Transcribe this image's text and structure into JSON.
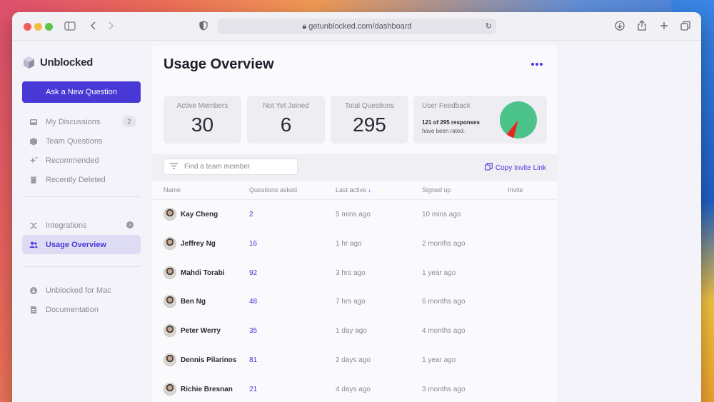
{
  "browser": {
    "url": "getunblocked.com/dashboard"
  },
  "sidebar": {
    "app_name": "Unblocked",
    "ask_button": "Ask a New Question",
    "items": [
      {
        "label": "My Discussions",
        "icon": "inbox-icon",
        "badge": "2"
      },
      {
        "label": "Team Questions",
        "icon": "cube-icon"
      },
      {
        "label": "Recommended",
        "icon": "sparkle-icon"
      },
      {
        "label": "Recently Deleted",
        "icon": "trash-icon"
      },
      {
        "label": "Integrations",
        "icon": "shuffle-icon"
      },
      {
        "label": "Usage Overview",
        "icon": "users-icon",
        "active": true
      },
      {
        "label": "Unblocked for Mac",
        "icon": "download-icon"
      },
      {
        "label": "Documentation",
        "icon": "document-icon"
      }
    ]
  },
  "main": {
    "title": "Usage Overview",
    "stats": [
      {
        "label": "Active Members",
        "value": "30"
      },
      {
        "label": "Not Yet Joined",
        "value": "6"
      },
      {
        "label": "Total Questions",
        "value": "295"
      }
    ],
    "feedback": {
      "label": "User Feedback",
      "line1": "121 of 295 responses",
      "line2": "have been rated.",
      "pie": [
        {
          "name": "rated-positive",
          "value": 93,
          "color": "#4cc38a"
        },
        {
          "name": "rated-negative",
          "value": 7,
          "color": "#e0291f"
        }
      ]
    },
    "search_placeholder": "Find a team member",
    "copy_link": "Copy Invite Link",
    "columns": [
      "Name",
      "Questions asked",
      "Last active",
      "Signed up",
      "Invite"
    ],
    "rows": [
      {
        "name": "Kay Cheng",
        "questions": "2",
        "last_active": "5 mins ago",
        "signed_up": "10 mins ago"
      },
      {
        "name": "Jeffrey Ng",
        "questions": "16",
        "last_active": "1 hr ago",
        "signed_up": "2 months ago"
      },
      {
        "name": "Mahdi Torabi",
        "questions": "92",
        "last_active": "3 hrs ago",
        "signed_up": "1 year ago"
      },
      {
        "name": "Ben Ng",
        "questions": "48",
        "last_active": "7 hrs ago",
        "signed_up": "6 months ago"
      },
      {
        "name": "Peter Werry",
        "questions": "35",
        "last_active": "1 day ago",
        "signed_up": "4 months ago"
      },
      {
        "name": "Dennis Pilarinos",
        "questions": "81",
        "last_active": "2 days ago",
        "signed_up": "1 year ago"
      },
      {
        "name": "Richie Bresnan",
        "questions": "21",
        "last_active": "4 days ago",
        "signed_up": "3 months ago"
      }
    ]
  }
}
